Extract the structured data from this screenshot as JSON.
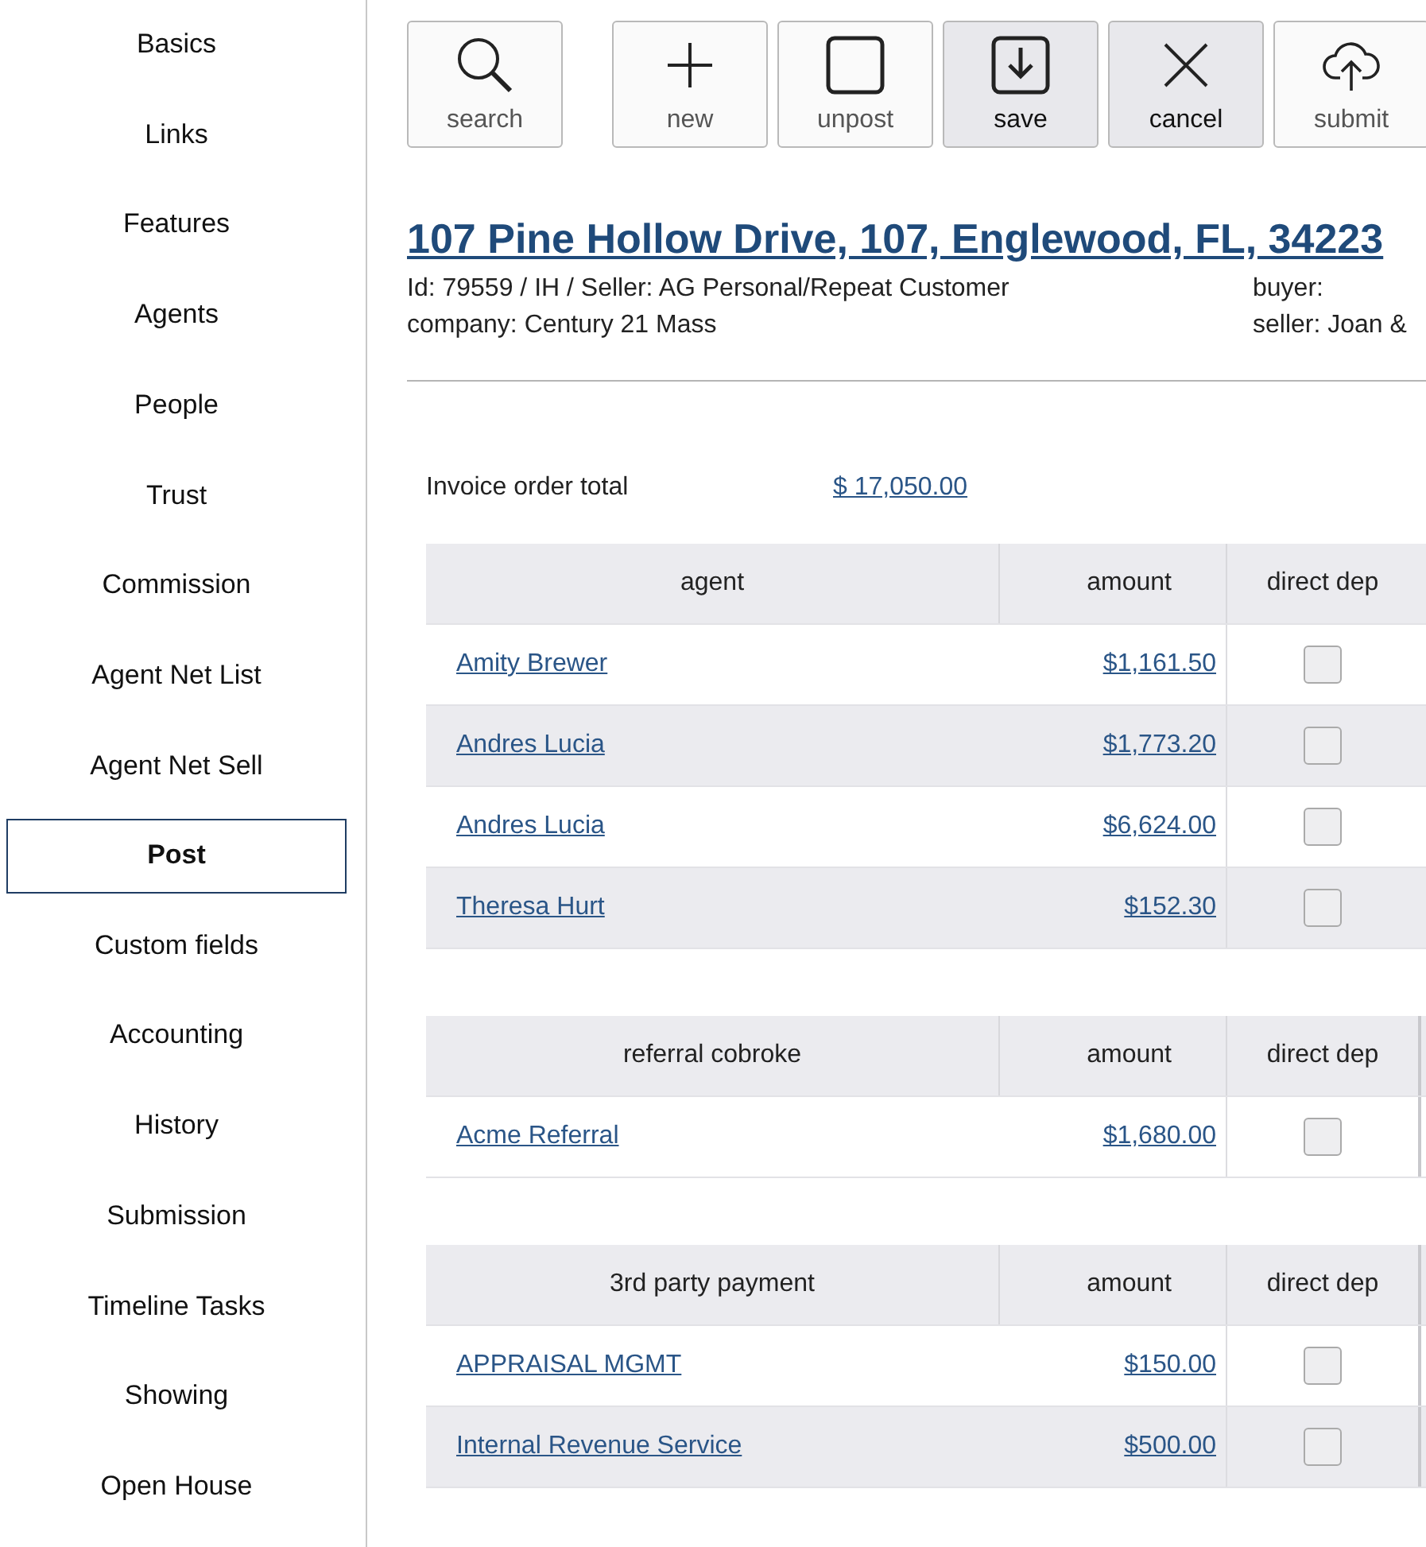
{
  "sidebar": {
    "items": [
      {
        "label": "Basics",
        "selected": false
      },
      {
        "label": "Links",
        "selected": false
      },
      {
        "label": "Features",
        "selected": false
      },
      {
        "label": "Agents",
        "selected": false
      },
      {
        "label": "People",
        "selected": false
      },
      {
        "label": "Trust",
        "selected": false
      },
      {
        "label": "Commission",
        "selected": false
      },
      {
        "label": "Agent Net List",
        "selected": false
      },
      {
        "label": "Agent Net Sell",
        "selected": false
      },
      {
        "label": "Post",
        "selected": true
      },
      {
        "label": "Custom fields",
        "selected": false
      },
      {
        "label": "Accounting",
        "selected": false
      },
      {
        "label": "History",
        "selected": false
      },
      {
        "label": "Submission",
        "selected": false
      },
      {
        "label": "Timeline Tasks",
        "selected": false
      },
      {
        "label": "Showing",
        "selected": false
      },
      {
        "label": "Open House",
        "selected": false
      }
    ]
  },
  "toolbar": {
    "groups": [
      [
        {
          "label": "search",
          "kind": "search",
          "highlighted": false
        }
      ],
      [
        {
          "label": "new",
          "kind": "plus",
          "highlighted": false
        },
        {
          "label": "unpost",
          "kind": "square",
          "highlighted": false
        },
        {
          "label": "save",
          "kind": "save",
          "highlighted": true
        },
        {
          "label": "cancel",
          "kind": "close",
          "highlighted": true
        },
        {
          "label": "submit",
          "kind": "upload",
          "highlighted": false
        }
      ]
    ]
  },
  "header": {
    "title": "107 Pine Hollow Drive, 107, Englewood, FL, 34223",
    "info_left": [
      "Id: 79559 / IH / Seller: AG Personal/Repeat Customer",
      "company: Century 21 Mass"
    ],
    "info_right": [
      "buyer:",
      "seller: Joan &"
    ]
  },
  "invoice_total": {
    "label": "Invoice order total",
    "value": "$ 17,050.00"
  },
  "tables": [
    {
      "columns": [
        "agent",
        "amount",
        "direct dep"
      ],
      "extra_column": false,
      "rows": [
        {
          "name": "Amity Brewer",
          "amount": "$1,161.50",
          "direct_dep": false
        },
        {
          "name": "Andres Lucia",
          "amount": "$1,773.20",
          "direct_dep": false
        },
        {
          "name": "Andres Lucia",
          "amount": "$6,624.00",
          "direct_dep": false
        },
        {
          "name": "Theresa Hurt",
          "amount": "$152.30",
          "direct_dep": false
        }
      ]
    },
    {
      "columns": [
        "referral cobroke",
        "amount",
        "direct dep"
      ],
      "extra_column": true,
      "rows": [
        {
          "name": "Acme Referral",
          "amount": "$1,680.00",
          "direct_dep": false
        }
      ]
    },
    {
      "columns": [
        "3rd party payment",
        "amount",
        "direct dep"
      ],
      "extra_column": true,
      "rows": [
        {
          "name": "APPRAISAL MGMT",
          "amount": "$150.00",
          "direct_dep": false
        },
        {
          "name": "Internal Revenue Service",
          "amount": "$500.00",
          "direct_dep": false
        }
      ]
    }
  ]
}
